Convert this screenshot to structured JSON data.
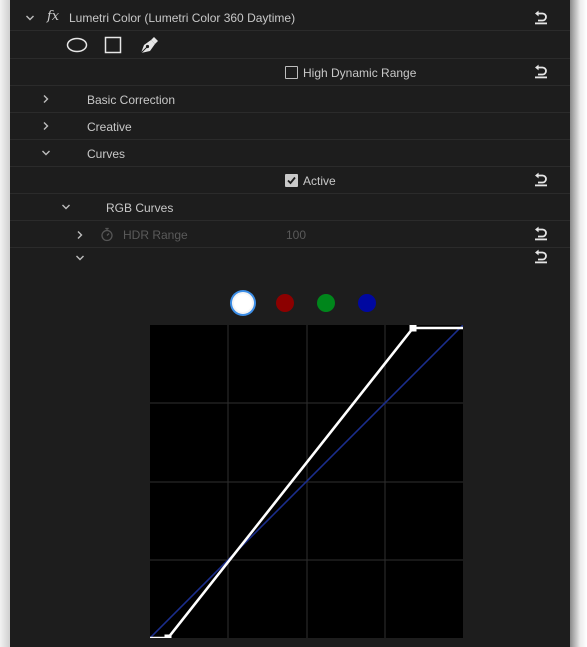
{
  "effect": {
    "fx_label": "fx",
    "title": "Lumetri Color (Lumetri Color 360 Daytime)"
  },
  "hdr": {
    "label": "High Dynamic Range",
    "checked": false
  },
  "sections": {
    "basic_correction": "Basic Correction",
    "creative": "Creative",
    "curves": "Curves"
  },
  "active": {
    "label": "Active",
    "checked": true
  },
  "rgb_curves": {
    "label": "RGB Curves",
    "hdr_range_label": "HDR Range",
    "hdr_range_value": "100"
  },
  "channels": [
    {
      "name": "white",
      "color": "#ffffff",
      "selected": true
    },
    {
      "name": "red",
      "color": "#8c0000",
      "selected": false
    },
    {
      "name": "green",
      "color": "#00861b",
      "selected": false
    },
    {
      "name": "blue",
      "color": "#0008a0",
      "selected": false
    }
  ],
  "colors": {
    "panel_bg": "#1d1d1d",
    "text": "#c8c8c8",
    "disabled_text": "#5a5a5a",
    "curve_white": "#ffffff",
    "curve_blue": "#1b2d8c",
    "selection_ring": "#3d8ee6"
  },
  "icons": [
    "ellipse-mask-icon",
    "rectangle-mask-icon",
    "pen-mask-icon",
    "reset-icon",
    "chevron-down-icon",
    "chevron-right-icon",
    "stopwatch-icon"
  ]
}
